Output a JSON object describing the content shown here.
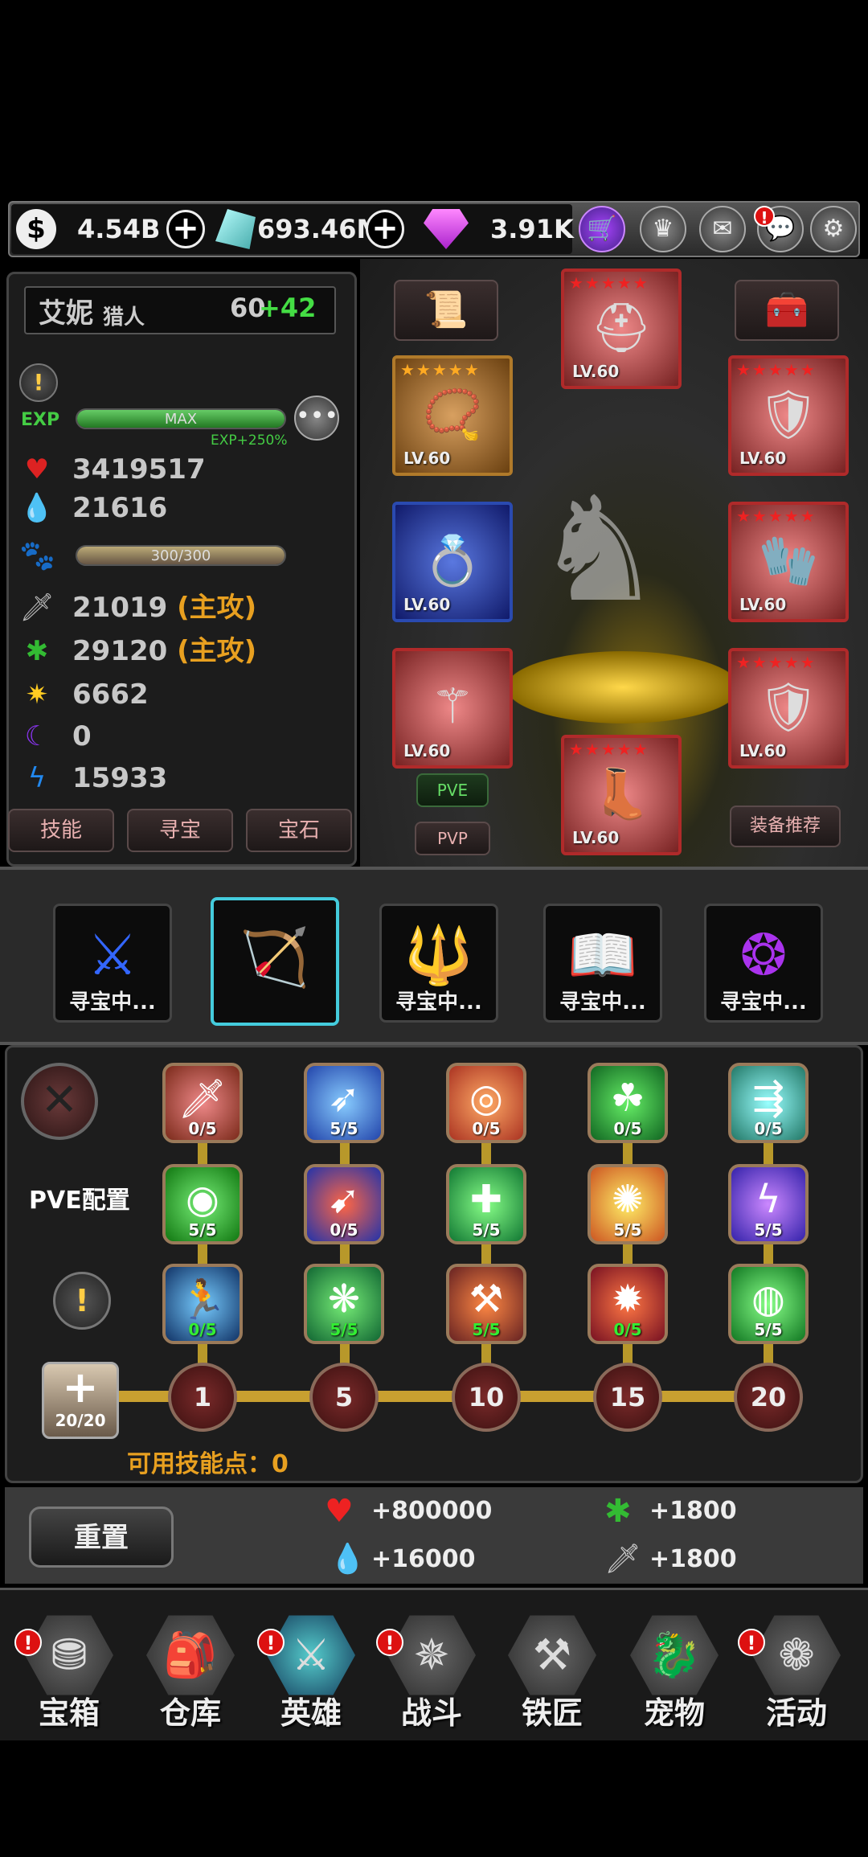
{
  "currency": {
    "gold": "4.54B",
    "crystal": "693.46M",
    "gem": "3.91K"
  },
  "hero": {
    "name": "艾妮",
    "class": "猎人",
    "level": "60",
    "level_bonus": "+42",
    "exp_label": "EXP",
    "exp_bar": "MAX",
    "exp_bonus": "EXP+250%",
    "pet_bar": "300/300",
    "stats": [
      {
        "icon": "heart-icon",
        "value": "3419517",
        "note": ""
      },
      {
        "icon": "water-drop-icon",
        "value": "21616",
        "note": ""
      },
      {
        "icon": "sword-icon",
        "value": "21019",
        "note": "(主攻)"
      },
      {
        "icon": "splat-icon",
        "value": "29120",
        "note": "(主攻)"
      },
      {
        "icon": "sun-icon",
        "value": "6662",
        "note": ""
      },
      {
        "icon": "moon-icon",
        "value": "0",
        "note": ""
      },
      {
        "icon": "lightning-icon",
        "value": "15933",
        "note": ""
      }
    ],
    "tabs": [
      "技能",
      "寻宝",
      "宝石"
    ]
  },
  "equipment": {
    "lv": "LV.60",
    "pve_label": "PVE",
    "pvp_label": "PVP",
    "recommend_label": "装备推荐"
  },
  "slots": {
    "caption": "寻宝中..."
  },
  "skills": {
    "config_label": "PVE配置",
    "rows": [
      [
        "0/5",
        "5/5",
        "0/5",
        "0/5",
        "0/5"
      ],
      [
        "5/5",
        "0/5",
        "5/5",
        "5/5",
        "5/5"
      ],
      [
        "0/5",
        "5/5",
        "5/5",
        "0/5",
        "5/5"
      ]
    ],
    "points_box": "20/20",
    "nodes": [
      "1",
      "5",
      "10",
      "15",
      "20"
    ],
    "available_points": "可用技能点：0"
  },
  "bonus": {
    "reset_label": "重置",
    "hp": "+800000",
    "mp": "+16000",
    "atk2": "+1800",
    "atk": "+1800"
  },
  "nav": [
    {
      "label": "宝箱",
      "icon": "chest-icon"
    },
    {
      "label": "仓库",
      "icon": "bag-icon"
    },
    {
      "label": "英雄",
      "icon": "hero-sword-icon"
    },
    {
      "label": "战斗",
      "icon": "battle-icon"
    },
    {
      "label": "铁匠",
      "icon": "anvil-icon"
    },
    {
      "label": "宠物",
      "icon": "pet-icon"
    },
    {
      "label": "活动",
      "icon": "event-icon"
    }
  ]
}
